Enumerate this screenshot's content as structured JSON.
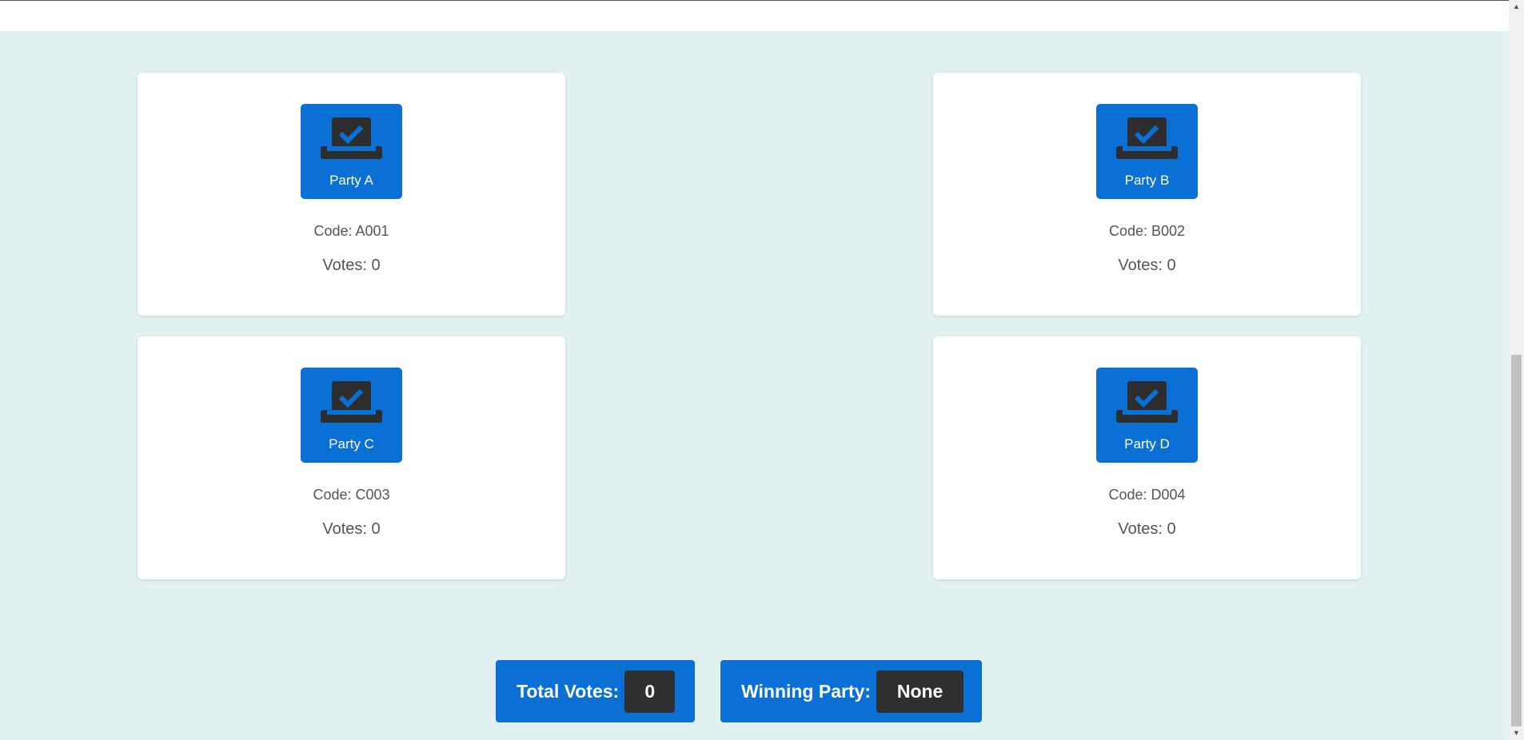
{
  "parties": [
    {
      "name": "Party A",
      "code_text": "Code: A001",
      "votes_text": "Votes: 0"
    },
    {
      "name": "Party B",
      "code_text": "Code: B002",
      "votes_text": "Votes: 0"
    },
    {
      "name": "Party C",
      "code_text": "Code: C003",
      "votes_text": "Votes: 0"
    },
    {
      "name": "Party D",
      "code_text": "Code: D004",
      "votes_text": "Votes: 0"
    }
  ],
  "summary": {
    "total_label": "Total Votes:",
    "total_value": "0",
    "winner_label": "Winning Party:",
    "winner_value": "None"
  },
  "icons": {
    "vote_button": "ballot-box-check-icon"
  },
  "colors": {
    "accent": "#0a70d6",
    "background": "#e2f1f2",
    "value_badge": "#2f2f2f"
  }
}
